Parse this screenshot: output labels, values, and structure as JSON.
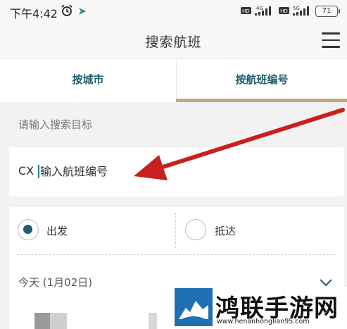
{
  "status_bar": {
    "time": "下午4:42",
    "hd1": "HD",
    "net1": "4G",
    "hd2": "HD",
    "net2": "5G",
    "battery": "71"
  },
  "header": {
    "title": "搜索航班"
  },
  "tabs": [
    {
      "label": "按城市",
      "active": false
    },
    {
      "label": "按航班编号",
      "active": true
    }
  ],
  "search": {
    "section_label": "请输入搜索目标",
    "prefix": "CX",
    "placeholder": "输入航班编号"
  },
  "options": {
    "depart_label": "出发",
    "arrive_label": "抵达",
    "selected": "出发",
    "date": "今天 (1月02日)"
  },
  "watermark": {
    "title": "鸿联手游网",
    "url": "www.henanhonglian95.com"
  },
  "colors": {
    "accent": "#1f5d6b",
    "tab_underline": "#c2a983",
    "arrow": "#c8201e"
  }
}
